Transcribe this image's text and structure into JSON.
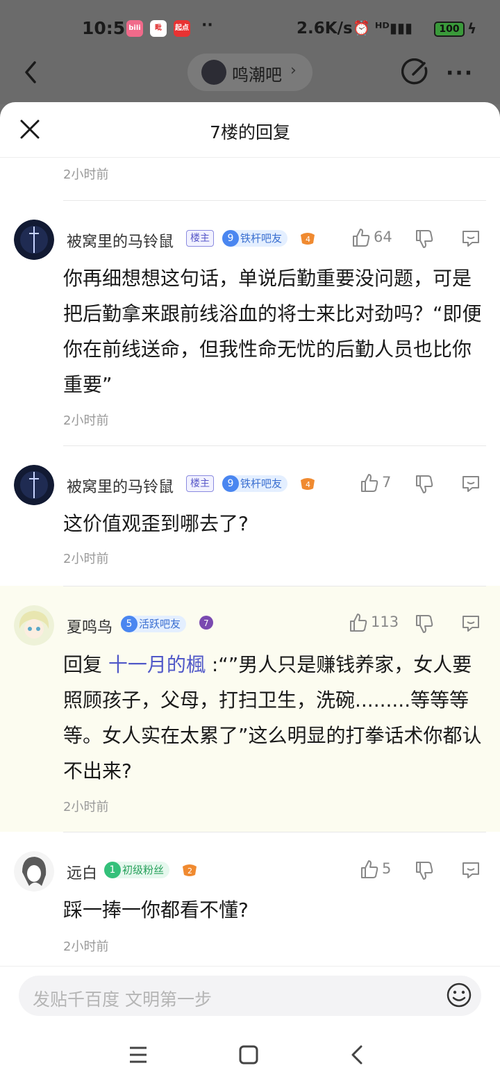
{
  "status_bar": {
    "time": "10:51",
    "app_icons": [
      {
        "label": "bili",
        "color": "#f06a8a"
      },
      {
        "label": "毗",
        "color": "#e02e2e"
      },
      {
        "label": "起点",
        "color": "#e83232"
      }
    ],
    "dots": "··",
    "speed": "2.6K/s",
    "icons_text": "⏰ ᴴᴰ▮▮▮",
    "battery": "100",
    "bolt": "ϟ"
  },
  "top_nav": {
    "forum_name": "鸣潮吧",
    "forum_arrow": "›"
  },
  "sheet": {
    "title": "7楼的回复",
    "top_time": "2小时前"
  },
  "comments": [
    {
      "username": "被窝里的马铃鼠",
      "owner_badge": "楼主",
      "level": "9",
      "level_title": "铁杆吧友",
      "game_badge": "4",
      "likes": "64",
      "content": "你再细想想这句话，单说后勤重要没问题，可是把后勤拿来跟前线浴血的将士来比对劲吗？“即便你在前线送命，但我性命无忧的后勤人员也比你重要”",
      "time": "2小时前"
    },
    {
      "username": "被窝里的马铃鼠",
      "owner_badge": "楼主",
      "level": "9",
      "level_title": "铁杆吧友",
      "game_badge": "4",
      "likes": "7",
      "content": "这价值观歪到哪去了?",
      "time": "2小时前"
    },
    {
      "username": "夏鸣鸟",
      "level": "5",
      "level_title": "活跃吧友",
      "game_badge": "7",
      "likes": "113",
      "reply_prefix": "回复",
      "mention": "十一月的楓",
      "content": ":“”男人只是赚钱养家，女人要照顾孩子，父母，打扫卫生，洗碗.........等等等等。女人实在太累了”这么明显的打拳话术你都认不出来?",
      "time": "2小时前"
    },
    {
      "username": "远白",
      "level": "1",
      "level_title": "初级粉丝",
      "game_badge": "2",
      "likes": "5",
      "content": "踩一捧一你都看不懂?",
      "time": "2小时前"
    }
  ],
  "input": {
    "placeholder": "发贴千百度 文明第一步"
  },
  "colors": {
    "accent": "#5058c8",
    "highlight_bg": "#fcfcf0",
    "level_blue": "#4a86f0",
    "level_green": "#34c07a"
  }
}
